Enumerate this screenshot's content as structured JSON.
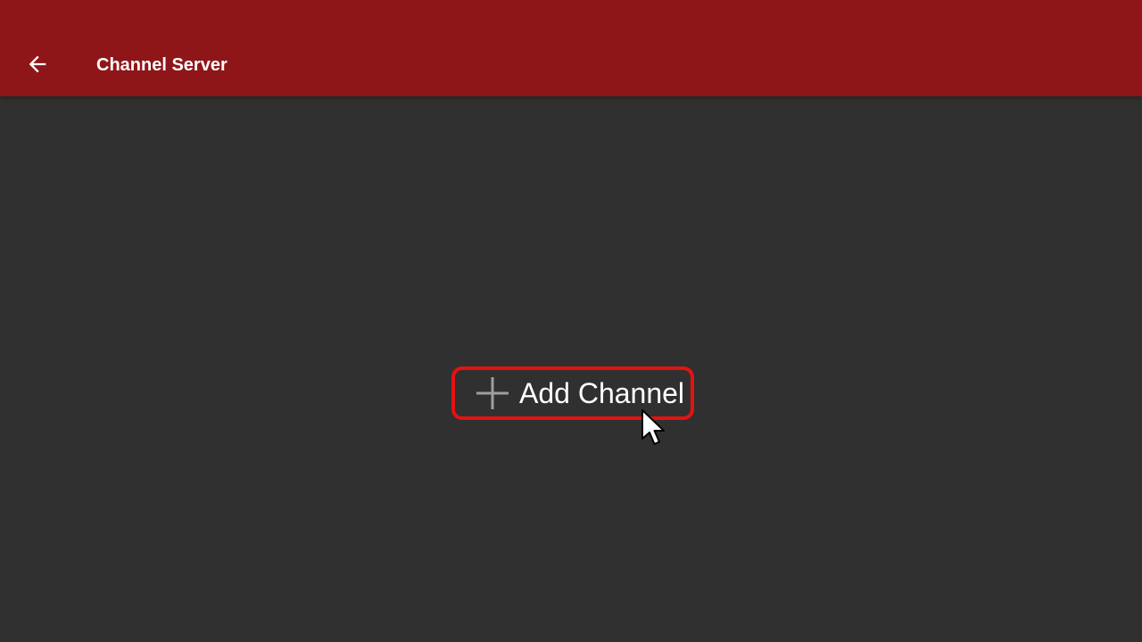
{
  "app_bar": {
    "title": "Channel Server",
    "back_icon": "arrow-left-icon",
    "color": "#8e1619"
  },
  "main": {
    "background": "#303030",
    "add_channel_button": {
      "label": "Add Channel",
      "icon": "plus-icon",
      "focus_color": "#e41212"
    }
  },
  "cursor": {
    "icon": "mouse-pointer-icon"
  }
}
